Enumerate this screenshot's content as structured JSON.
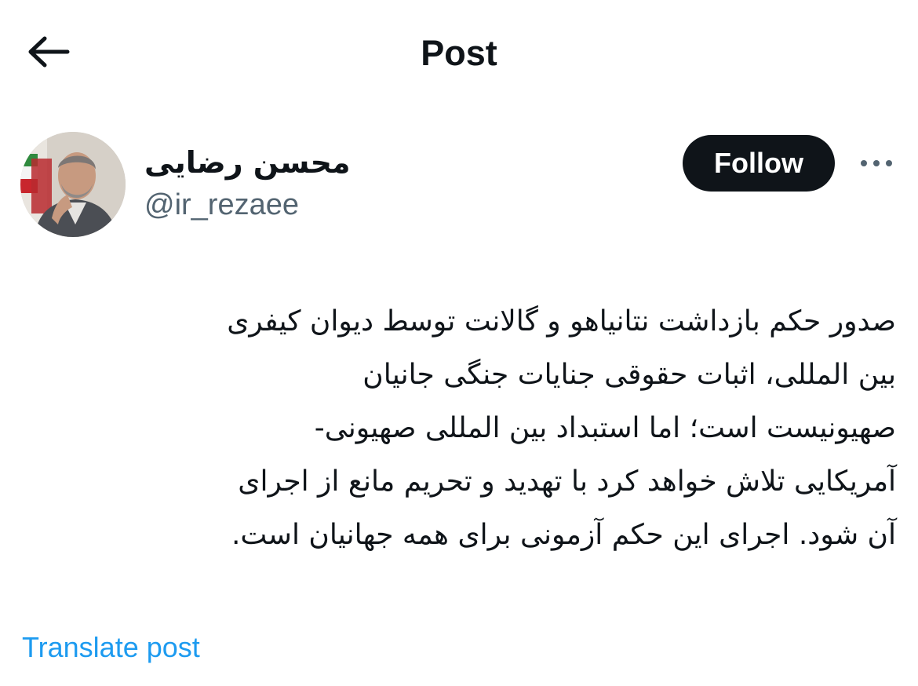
{
  "header": {
    "title": "Post",
    "back_icon": "arrow-left-icon"
  },
  "author": {
    "display_name": "محسن رضایی",
    "handle": "@ir_rezaee",
    "follow_label": "Follow",
    "more_icon": "more-horizontal-icon"
  },
  "post": {
    "lines": [
      "صدور حکم بازداشت نتانیاهو و گالانت توسط دیوان کیفری",
      "بین المللی، اثبات حقوقی جنایات جنگی جانیان",
      "صهیونیست است؛ اما استبداد بین المللی صهیونی-",
      "آمریکایی تلاش خواهد کرد با تهدید و تحریم مانع از اجرای",
      "آن شود. اجرای این حکم آزمونی برای همه جهانیان است."
    ]
  },
  "translate": {
    "label": "Translate post",
    "color": "#1d9bf0"
  },
  "colors": {
    "text": "#0f1419",
    "secondary": "#536471",
    "button_bg": "#0f1419"
  }
}
